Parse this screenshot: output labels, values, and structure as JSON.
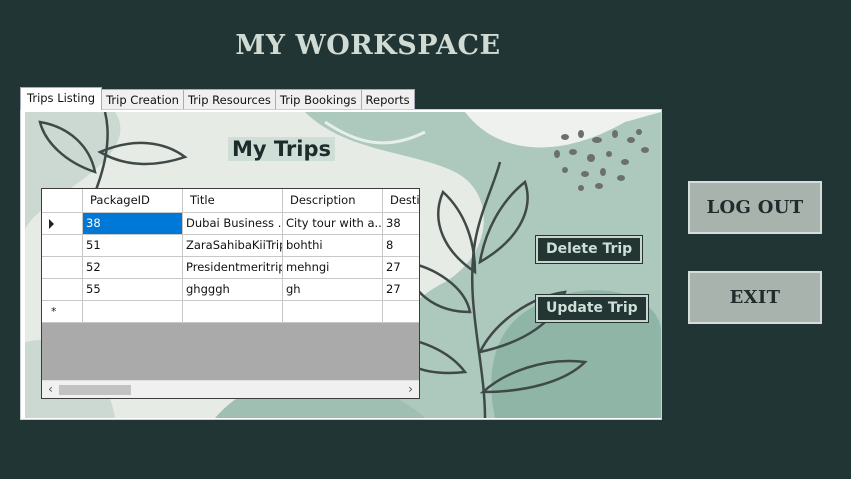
{
  "app": {
    "title": "MY WORKSPACE"
  },
  "tabs": [
    {
      "label": "Trips Listing",
      "active": true
    },
    {
      "label": "Trip Creation"
    },
    {
      "label": "Trip Resources"
    },
    {
      "label": "Trip Bookings"
    },
    {
      "label": "Reports"
    }
  ],
  "trips": {
    "heading": "My Trips",
    "grid": {
      "columns": [
        "PackageID",
        "Title",
        "Description",
        "Destin"
      ],
      "rows": [
        [
          "38",
          "Dubai Business ...",
          "City tour with a...",
          "38"
        ],
        [
          "51",
          "ZaraSahibaKiiTrip",
          "bohthi",
          "8"
        ],
        [
          "52",
          "Presidentmeritrip",
          "mehngi",
          "27"
        ],
        [
          "55",
          "ghgggh",
          "gh",
          "27"
        ]
      ],
      "selected_row": 0,
      "new_row_marker": "*"
    },
    "delete_label": "Delete Trip",
    "update_label": "Update Trip"
  },
  "side": {
    "logout_label": "LOG OUT",
    "exit_label": "EXIT"
  },
  "colors": {
    "background": "#223535",
    "accent": "#0078d7",
    "button_dark": "#233634",
    "side_button": "#a9b3ae"
  },
  "icons": {
    "row_indicator": "triangle-right-icon",
    "scroll_left": "chevron-left-icon",
    "scroll_right": "chevron-right-icon"
  }
}
